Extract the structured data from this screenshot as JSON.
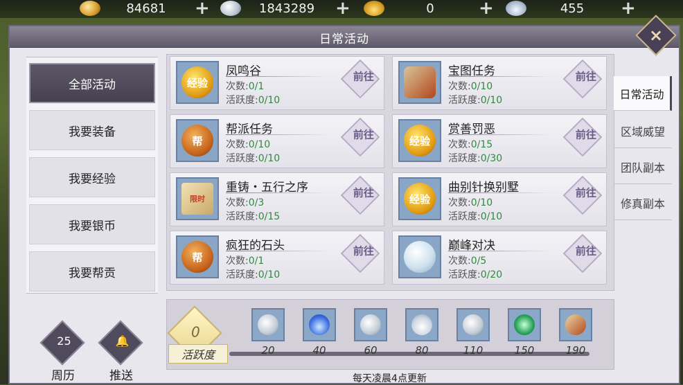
{
  "currencies": [
    {
      "icon": "gold-coin-icon",
      "value": "84681"
    },
    {
      "icon": "silver-coin-icon",
      "value": "1843289"
    },
    {
      "icon": "gold-ingot-icon",
      "value": "0"
    },
    {
      "icon": "silver-ingot-icon",
      "value": "455"
    }
  ],
  "window": {
    "title": "日常活动"
  },
  "categories": [
    "全部活动",
    "我要装备",
    "我要经验",
    "我要银币",
    "我要帮贡"
  ],
  "activities": [
    {
      "name": "凤鸣谷",
      "count_label": "次数:",
      "count": "0/1",
      "active_label": "活跃度:",
      "active": "0/10",
      "icon": "exp-orb-icon",
      "badge": "经验",
      "go": "前往"
    },
    {
      "name": "宝图任务",
      "count_label": "次数:",
      "count": "0/10",
      "active_label": "活跃度:",
      "active": "0/10",
      "icon": "scroll-icon",
      "badge": "",
      "go": "前往"
    },
    {
      "name": "帮派任务",
      "count_label": "次数:",
      "count": "0/10",
      "active_label": "活跃度:",
      "active": "0/10",
      "icon": "guild-badge-icon",
      "badge": "帮",
      "go": "前往"
    },
    {
      "name": "赏善罚恶",
      "count_label": "次数:",
      "count": "0/15",
      "active_label": "活跃度:",
      "active": "0/30",
      "icon": "exp-orb-icon",
      "badge": "经验",
      "go": "前往"
    },
    {
      "name": "重铸・五行之序",
      "count_label": "次数:",
      "count": "0/3",
      "active_label": "活跃度:",
      "active": "0/15",
      "icon": "limited-map-icon",
      "badge": "限时",
      "go": "前往"
    },
    {
      "name": "曲别针换别墅",
      "count_label": "次数:",
      "count": "0/10",
      "active_label": "活跃度:",
      "active": "0/10",
      "icon": "exp-orb-icon",
      "badge": "经验",
      "go": "前往"
    },
    {
      "name": "疯狂的石头",
      "count_label": "次数:",
      "count": "0/1",
      "active_label": "活跃度:",
      "active": "0/10",
      "icon": "guild-badge-icon",
      "badge": "帮",
      "go": "前往"
    },
    {
      "name": "巅峰对决",
      "count_label": "次数:",
      "count": "0/5",
      "active_label": "活跃度:",
      "active": "0/20",
      "icon": "silver-gem-icon",
      "badge": "",
      "go": "前往"
    }
  ],
  "tabs": [
    "日常活动",
    "区域威望",
    "团队副本",
    "修真副本"
  ],
  "progress": {
    "current": "0",
    "label": "活跃度",
    "milestones": [
      "20",
      "40",
      "60",
      "80",
      "110",
      "150",
      "190"
    ],
    "reward_icons": [
      "silver-coin-icon",
      "blue-flame-icon",
      "silver-coin-icon",
      "silver-ingot-icon",
      "silver-coin-icon",
      "green-gem-icon",
      "scroll-icon"
    ],
    "footer": "每天凌晨4点更新"
  },
  "bottom_buttons": [
    {
      "label": "周历",
      "icon_text": "25",
      "icon": "calendar-icon"
    },
    {
      "label": "推送",
      "icon_text": "🔔",
      "icon": "bell-icon"
    }
  ]
}
